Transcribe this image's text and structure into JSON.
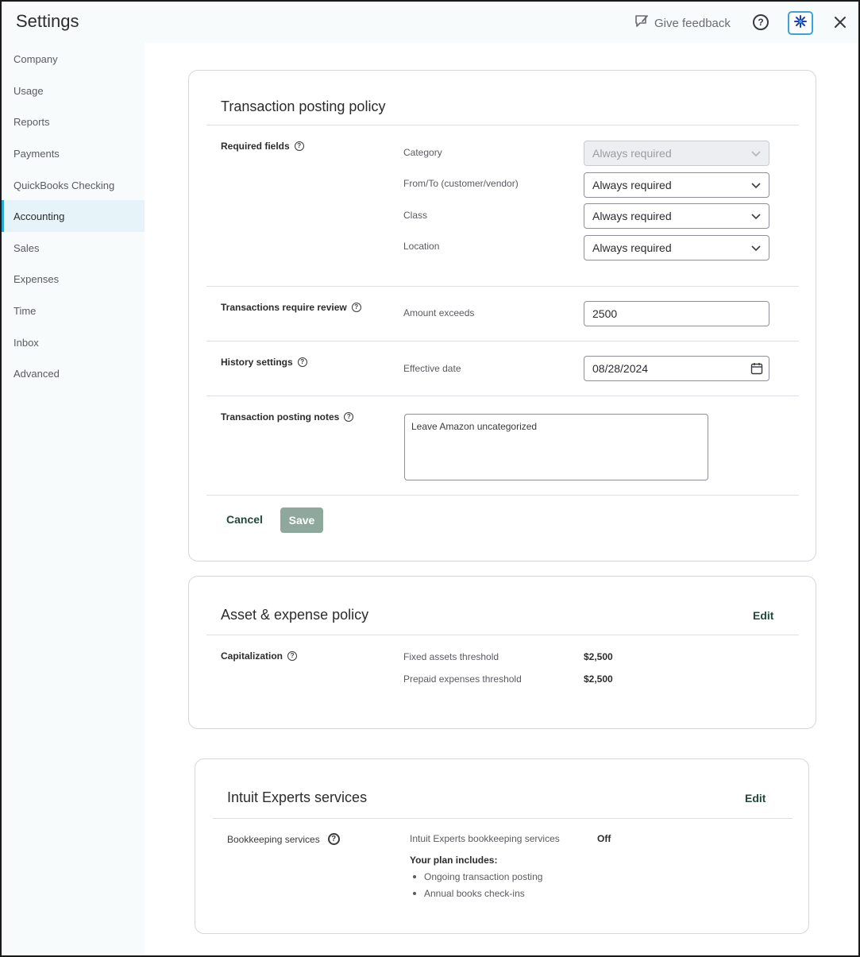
{
  "header": {
    "title": "Settings",
    "feedback_label": "Give feedback",
    "help_glyph": "?"
  },
  "sidebar": {
    "items": [
      {
        "label": "Company"
      },
      {
        "label": "Usage"
      },
      {
        "label": "Reports"
      },
      {
        "label": "Payments"
      },
      {
        "label": "QuickBooks Checking"
      },
      {
        "label": "Accounting",
        "active": true
      },
      {
        "label": "Sales"
      },
      {
        "label": "Expenses"
      },
      {
        "label": "Time"
      },
      {
        "label": "Inbox"
      },
      {
        "label": "Advanced"
      }
    ]
  },
  "posting_policy": {
    "title": "Transaction posting policy",
    "required_fields": {
      "label": "Required fields",
      "rows": [
        {
          "label": "Category",
          "value": "Always required",
          "disabled": true
        },
        {
          "label": "From/To (customer/vendor)",
          "value": "Always required"
        },
        {
          "label": "Class",
          "value": "Always required"
        },
        {
          "label": "Location",
          "value": "Always required"
        }
      ]
    },
    "review": {
      "label": "Transactions require review",
      "field_label": "Amount exceeds",
      "value": "2500"
    },
    "history": {
      "label": "History settings",
      "field_label": "Effective date",
      "value": "08/28/2024"
    },
    "notes": {
      "label": "Transaction posting notes",
      "value": "Leave Amazon uncategorized"
    },
    "cancel_label": "Cancel",
    "save_label": "Save"
  },
  "asset_policy": {
    "title": "Asset & expense policy",
    "edit_label": "Edit",
    "capitalization_label": "Capitalization",
    "rows": [
      {
        "label": "Fixed assets threshold",
        "value": "$2,500"
      },
      {
        "label": "Prepaid expenses threshold",
        "value": "$2,500"
      }
    ]
  },
  "experts": {
    "title": "Intuit Experts services",
    "edit_label": "Edit",
    "bookkeeping_label": "Bookkeeping services",
    "service_label": "Intuit Experts bookkeeping services",
    "service_value": "Off",
    "plan_heading": "Your plan includes:",
    "plan_items": [
      "Ongoing transaction posting",
      "Annual books check-ins"
    ]
  },
  "colors": {
    "accent": "#2ca5d8",
    "primary_text_button": "#1f4a3a",
    "save_disabled": "#8fa89e",
    "sidebar_bg": "#f7fbfc"
  }
}
